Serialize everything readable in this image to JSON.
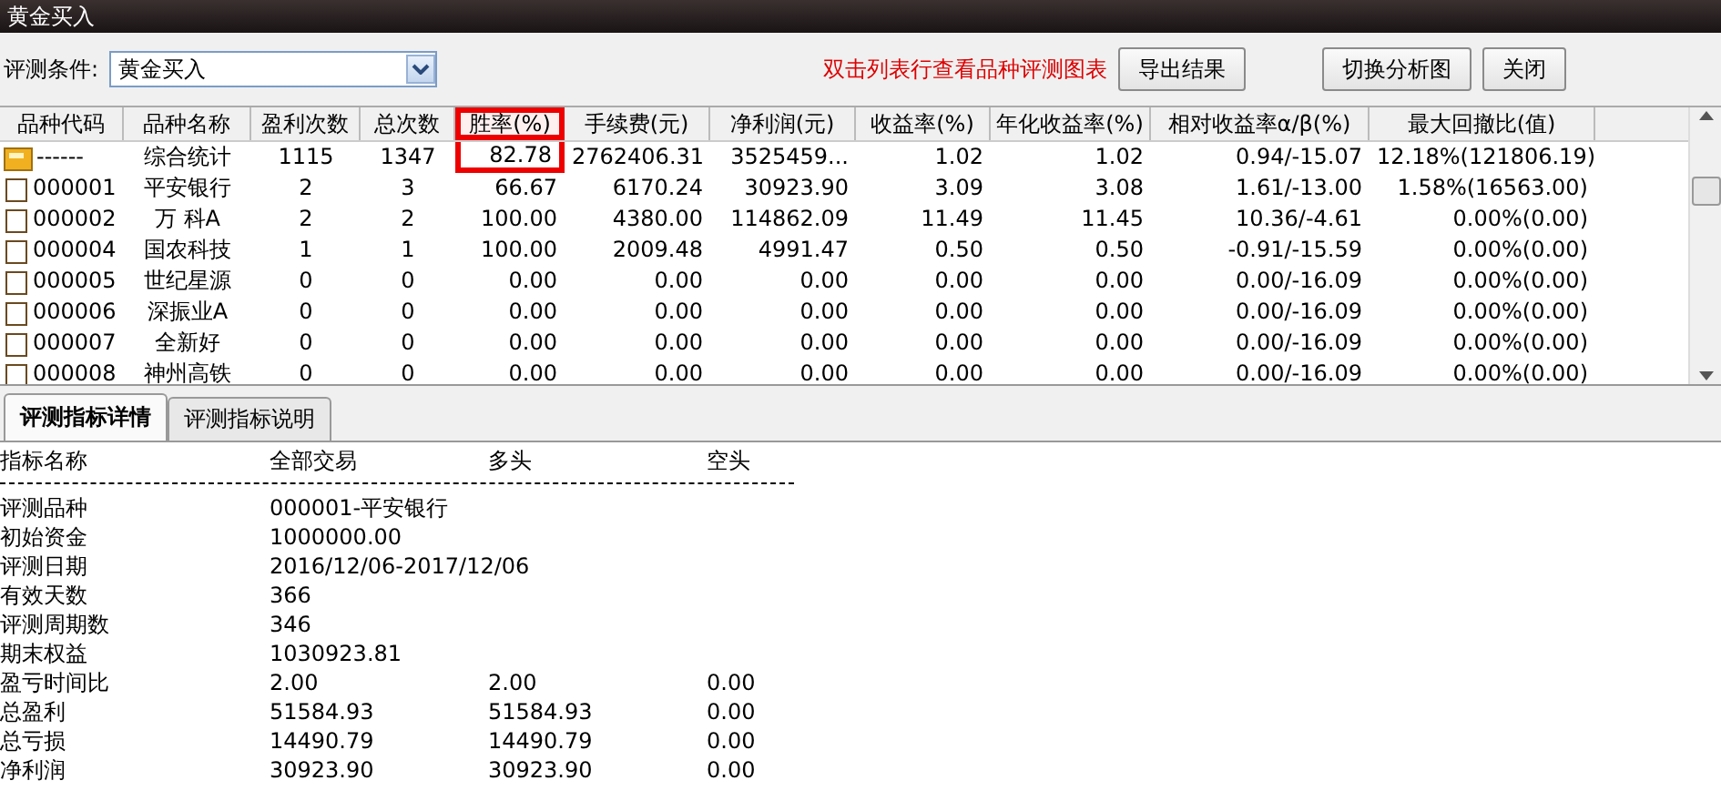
{
  "window": {
    "title": "黄金买入"
  },
  "toolbar": {
    "condition_label": "评测条件:",
    "condition_value": "黄金买入",
    "hint": "双击列表行查看品种评测图表",
    "buttons": [
      "导出结果",
      "切换分析图",
      "关闭"
    ]
  },
  "table": {
    "columns": [
      {
        "label": "品种代码",
        "highlighted": false
      },
      {
        "label": "品种名称",
        "highlighted": false
      },
      {
        "label": "盈利次数",
        "highlighted": false
      },
      {
        "label": "总次数",
        "highlighted": false
      },
      {
        "label": "胜率(%)",
        "highlighted": true
      },
      {
        "label": "手续费(元)",
        "highlighted": false
      },
      {
        "label": "净利润(元)",
        "highlighted": false
      },
      {
        "label": "收益率(%)",
        "highlighted": false
      },
      {
        "label": "年化收益率(%)",
        "highlighted": false
      },
      {
        "label": "相对收益率α/β(%)",
        "highlighted": false
      },
      {
        "label": "最大回撤比(值)",
        "highlighted": false
      }
    ],
    "rows": [
      {
        "kind": "summary",
        "cells": [
          "------",
          "综合统计",
          "1115",
          "1347",
          "82.78",
          "2762406.31",
          "3525459...",
          "1.02",
          "1.02",
          "0.94/-15.07",
          "12.18%(121806.19)"
        ]
      },
      {
        "kind": "stock",
        "cells": [
          "000001",
          "平安银行",
          "2",
          "3",
          "66.67",
          "6170.24",
          "30923.90",
          "3.09",
          "3.08",
          "1.61/-13.00",
          "1.58%(16563.00)"
        ]
      },
      {
        "kind": "stock",
        "cells": [
          "000002",
          "万 科A",
          "2",
          "2",
          "100.00",
          "4380.00",
          "114862.09",
          "11.49",
          "11.45",
          "10.36/-4.61",
          "0.00%(0.00)"
        ]
      },
      {
        "kind": "stock",
        "cells": [
          "000004",
          "国农科技",
          "1",
          "1",
          "100.00",
          "2009.48",
          "4991.47",
          "0.50",
          "0.50",
          "-0.91/-15.59",
          "0.00%(0.00)"
        ]
      },
      {
        "kind": "stock",
        "cells": [
          "000005",
          "世纪星源",
          "0",
          "0",
          "0.00",
          "0.00",
          "0.00",
          "0.00",
          "0.00",
          "0.00/-16.09",
          "0.00%(0.00)"
        ]
      },
      {
        "kind": "stock",
        "cells": [
          "000006",
          "深振业A",
          "0",
          "0",
          "0.00",
          "0.00",
          "0.00",
          "0.00",
          "0.00",
          "0.00/-16.09",
          "0.00%(0.00)"
        ]
      },
      {
        "kind": "stock",
        "cells": [
          "000007",
          "全新好",
          "0",
          "0",
          "0.00",
          "0.00",
          "0.00",
          "0.00",
          "0.00",
          "0.00/-16.09",
          "0.00%(0.00)"
        ]
      },
      {
        "kind": "stock",
        "cells": [
          "000008",
          "神州高铁",
          "0",
          "0",
          "0.00",
          "0.00",
          "0.00",
          "0.00",
          "0.00",
          "0.00/-16.09",
          "0.00%(0.00)"
        ]
      }
    ]
  },
  "tabs": [
    {
      "label": "评测指标详情",
      "selected": true
    },
    {
      "label": "评测指标说明",
      "selected": false
    }
  ],
  "details": {
    "columns": [
      "指标名称",
      "全部交易",
      "多头",
      "空头"
    ],
    "rows": [
      [
        "评测品种",
        "000001-平安银行"
      ],
      [
        "初始资金",
        "1000000.00"
      ],
      [
        "评测日期",
        "2016/12/06-2017/12/06"
      ],
      [
        "有效天数",
        "366"
      ],
      [
        "评测周期数",
        "346"
      ],
      [
        "期末权益",
        "1030923.81"
      ],
      [
        "盈亏时间比",
        "2.00",
        "2.00",
        "0.00"
      ],
      [
        "总盈利",
        "51584.93",
        "51584.93",
        "0.00"
      ],
      [
        "总亏损",
        "14490.79",
        "14490.79",
        "0.00"
      ],
      [
        "净利润",
        "30923.90",
        "30923.90",
        "0.00"
      ]
    ]
  }
}
